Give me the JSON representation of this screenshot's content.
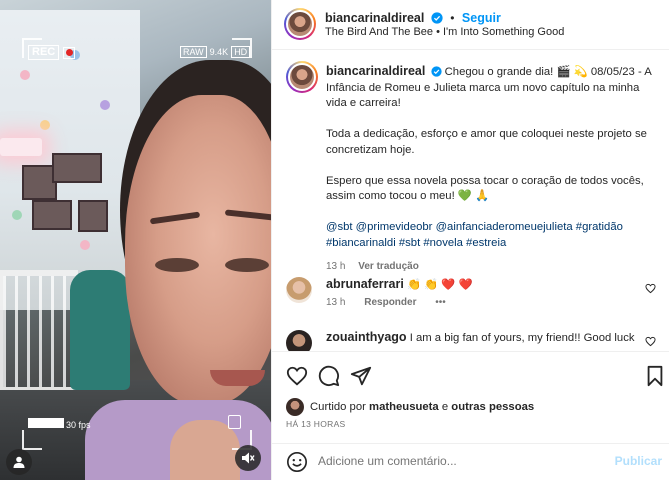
{
  "media": {
    "rec_label": "REC",
    "raw_label": "RAW",
    "raw_value": "9.4K",
    "raw_badge": "HD",
    "fps_label": "30 fps"
  },
  "header": {
    "username": "biancarinaldireal",
    "follow_label": "Seguir",
    "separator": "•",
    "audio": "The Bird And The Bee • I'm Into Something Good"
  },
  "caption": {
    "username": "biancarinaldireal",
    "line1": "Chegou o grande dia! 🎬 💫 08/05/23 - A Infância de Romeu e Julieta marca um novo capítulo na minha vida e carreira!",
    "line2": "Toda a dedicação, esforço e amor que coloquei neste projeto se concretizam hoje.",
    "line3": "Espero que essa novela possa tocar o coração de todos vocês, assim como tocou o meu! 💚 🙏",
    "tags": "@sbt @primevideobr @ainfanciaderomeuejulieta #gratidão #biancarinaldi #sbt #novela #estreia",
    "time": "13 h",
    "translate_label": "Ver tradução"
  },
  "comments": [
    {
      "username": "abrunaferrari",
      "text": "👏 👏 ❤️ ❤️",
      "time": "13 h",
      "reply_label": "Responder",
      "more": "•••"
    },
    {
      "username": "zouainthyago",
      "text": "I am a big fan of yours, my friend!! Good luck"
    }
  ],
  "actions": {
    "liked_prefix": "Curtido por",
    "liked_user": "matheusueta",
    "liked_conj": "e",
    "liked_others": "outras pessoas",
    "timestamp": "HÁ 13 HORAS"
  },
  "add_comment": {
    "placeholder": "Adicione um comentário...",
    "publish_label": "Publicar"
  },
  "colors": {
    "link_blue": "#0095f6",
    "hashtag": "#00376b",
    "secondary_text": "#737373",
    "publish_disabled": "#b2dffc"
  }
}
